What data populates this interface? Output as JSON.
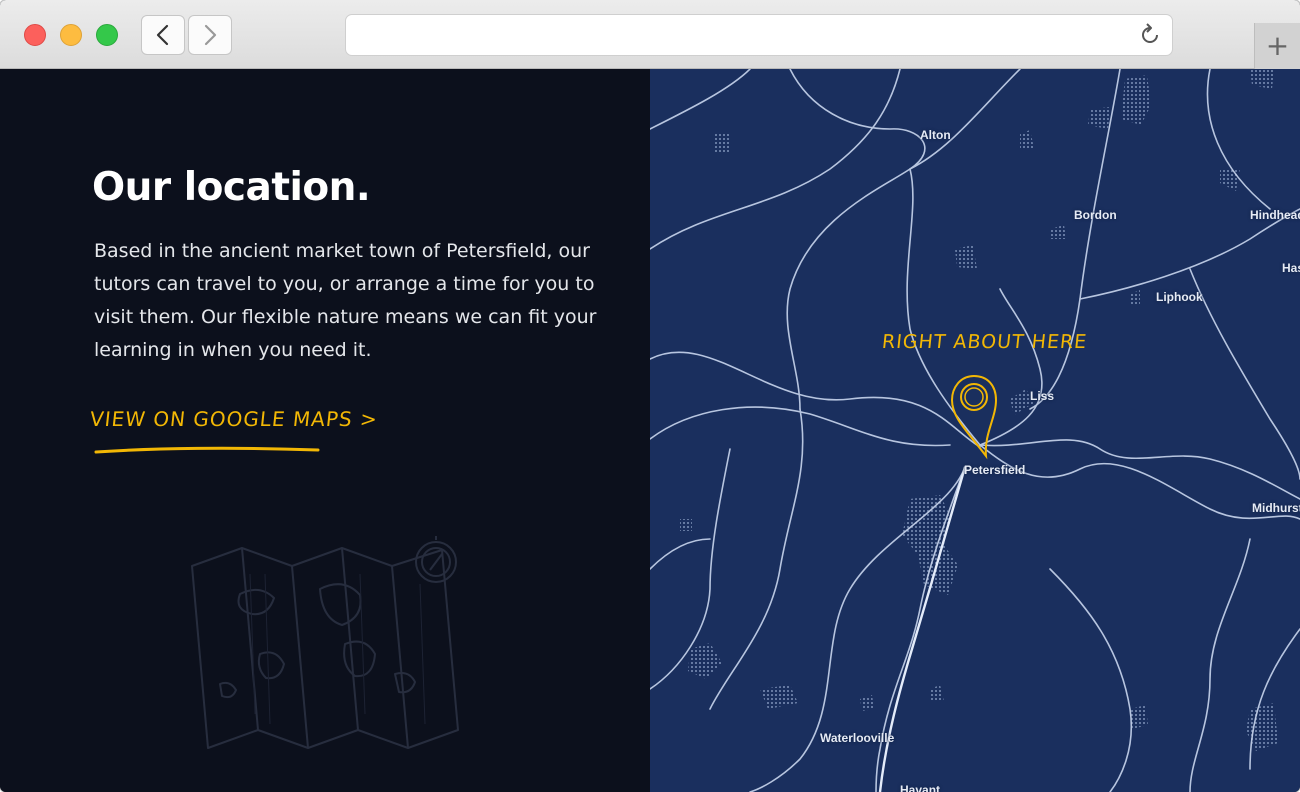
{
  "browser": {
    "url": "",
    "new_tab_symbol": "+"
  },
  "page": {
    "heading": "Our location.",
    "body": "Based in the ancient market town of Petersfield, our tutors can travel to you, or arrange a time for you to visit them. Our flexible nature means we can fit your learning in when you need it.",
    "maps_link": "VIEW ON GOOGLE MAPS >"
  },
  "map": {
    "annotation": "RIGHT ABOUT HERE",
    "places": {
      "alton": "Alton",
      "bordon": "Bordon",
      "hindhead": "Hindhead",
      "haslemere": "Has",
      "liphook": "Liphook",
      "liss": "Liss",
      "petersfield": "Petersfield",
      "midhurst": "Midhurst",
      "waterlooville": "Waterlooville",
      "havant": "Havant"
    }
  },
  "colors": {
    "left_background": "#0c101c",
    "map_background": "#1a2f5e",
    "accent": "#f2b705"
  },
  "icons": {
    "back": "chevron-left-icon",
    "forward": "chevron-right-icon",
    "reload": "reload-icon",
    "pin": "map-pin-icon",
    "illustration": "folded-map-compass-illustration"
  }
}
